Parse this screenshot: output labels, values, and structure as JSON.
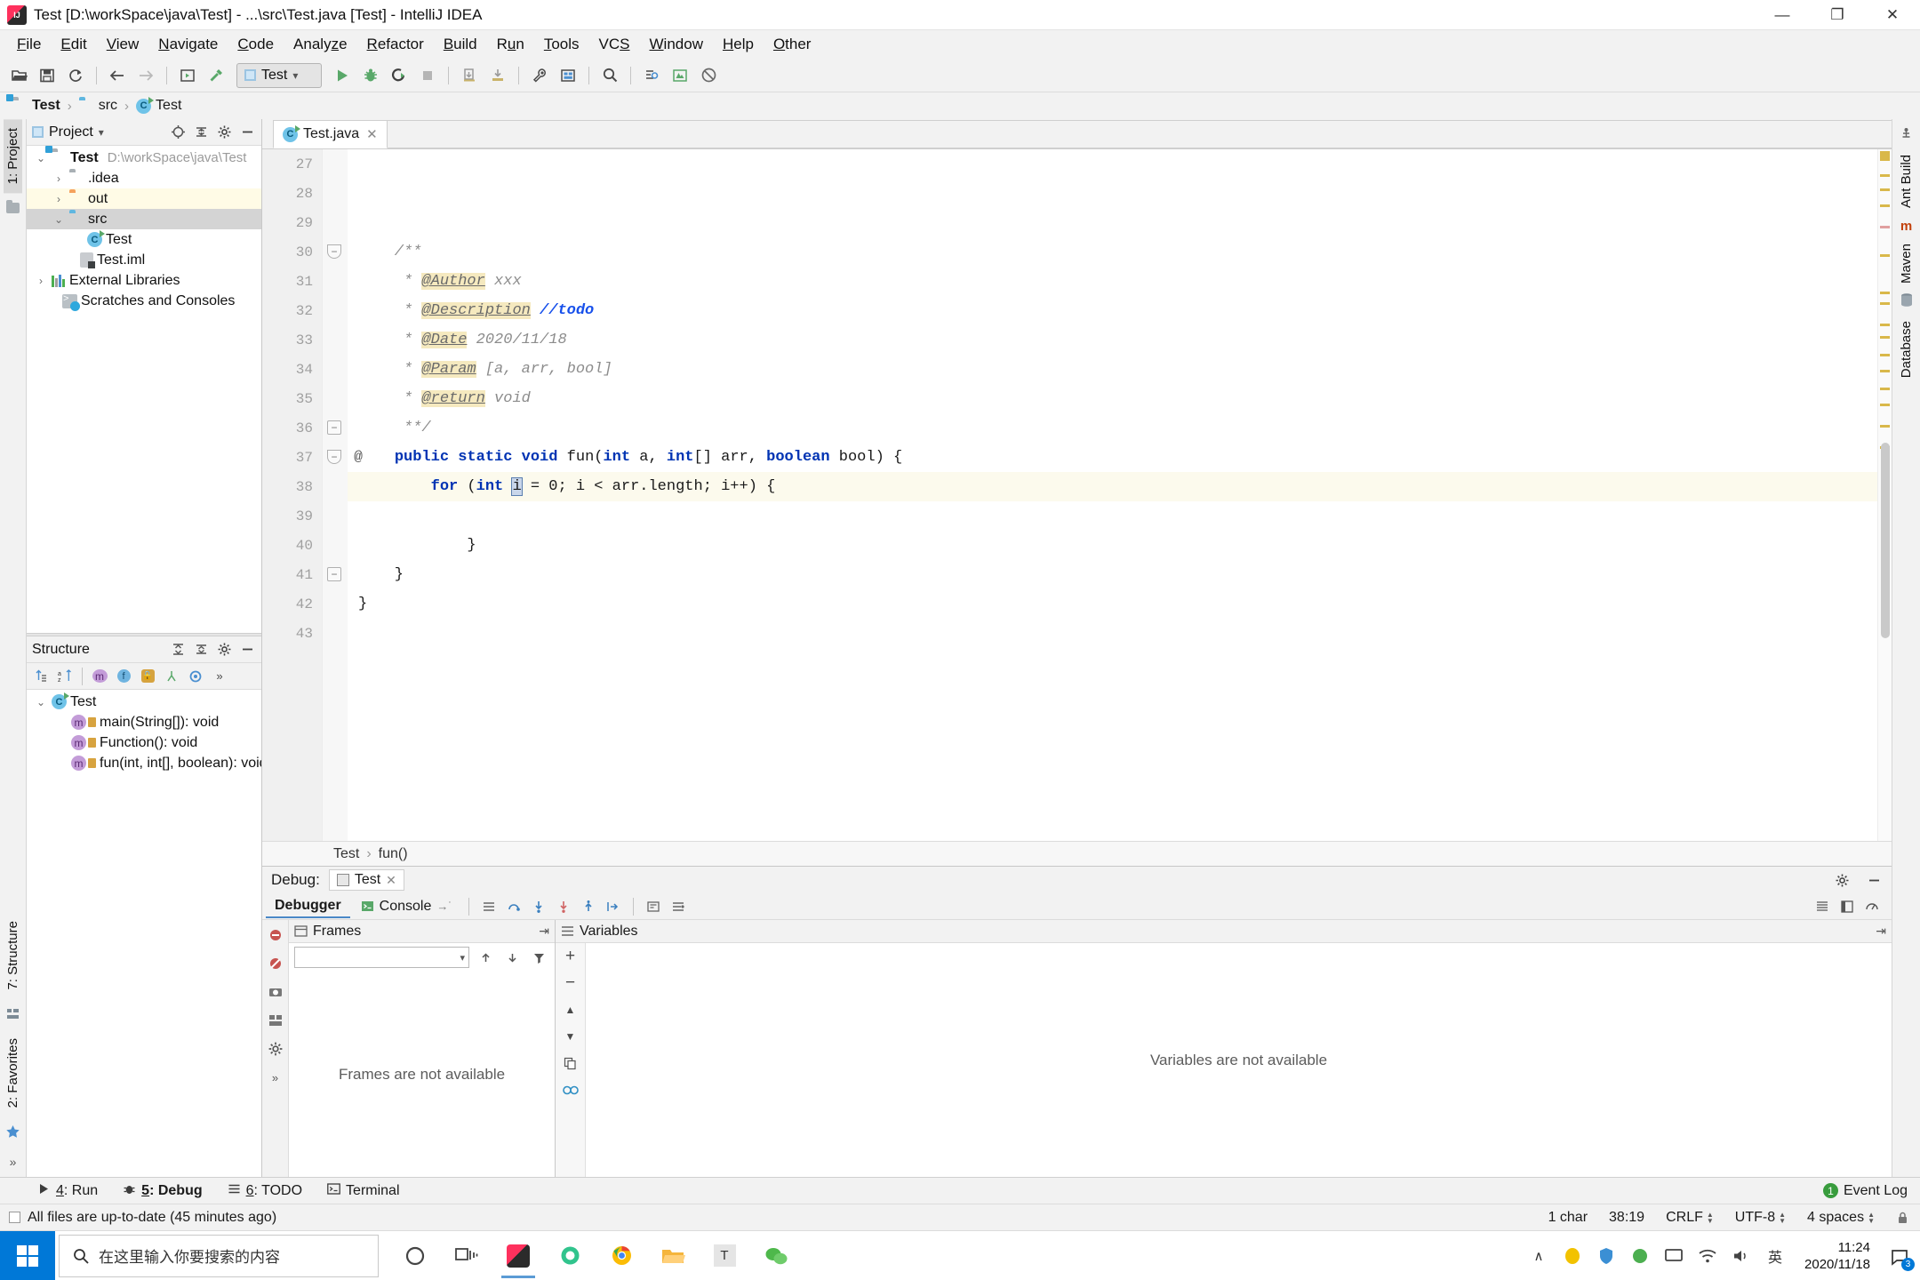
{
  "window": {
    "title": "Test [D:\\workSpace\\java\\Test] - ...\\src\\Test.java [Test] - IntelliJ IDEA",
    "app_icon": "intellij-idea-icon",
    "minimize": "—",
    "maximize": "❐",
    "close": "✕"
  },
  "menubar": {
    "items": [
      {
        "label": "File",
        "mnemonic": "F"
      },
      {
        "label": "Edit",
        "mnemonic": "E"
      },
      {
        "label": "View",
        "mnemonic": "V"
      },
      {
        "label": "Navigate",
        "mnemonic": "N"
      },
      {
        "label": "Code",
        "mnemonic": "C"
      },
      {
        "label": "Analyze",
        "mnemonic": "z"
      },
      {
        "label": "Refactor",
        "mnemonic": "R"
      },
      {
        "label": "Build",
        "mnemonic": "B"
      },
      {
        "label": "Run",
        "mnemonic": "u"
      },
      {
        "label": "Tools",
        "mnemonic": "T"
      },
      {
        "label": "VCS",
        "mnemonic": "S"
      },
      {
        "label": "Window",
        "mnemonic": "W"
      },
      {
        "label": "Help",
        "mnemonic": "H"
      },
      {
        "label": "Other",
        "mnemonic": "O"
      }
    ]
  },
  "toolbar": {
    "run_config": "Test",
    "icons": [
      "open-project-icon",
      "save-all-icon",
      "sync-icon",
      "back-icon",
      "forward-icon",
      "run-configurations-icon",
      "build-hammer-icon",
      "run-icon",
      "debug-icon",
      "run-with-coverage-icon",
      "stop-icon",
      "update-project-icon",
      "commit-icon",
      "settings-wrench-icon",
      "project-structure-icon",
      "search-everywhere-icon",
      "find-in-path-icon",
      "ant-build-icon",
      "no-access-icon"
    ]
  },
  "breadcrumb": {
    "items": [
      {
        "label": "Test",
        "icon": "module-folder-icon"
      },
      {
        "label": "src",
        "icon": "source-folder-icon"
      },
      {
        "label": "Test",
        "icon": "java-class-icon"
      }
    ],
    "separator": "›"
  },
  "left_strip": {
    "project_tab": "1: Project",
    "structure_tab": "7: Structure",
    "favorites_tab": "2: Favorites",
    "more": "»"
  },
  "right_strip": {
    "ant_build": "Ant Build",
    "maven": "Maven",
    "database": "Database"
  },
  "project_panel": {
    "title": "Project",
    "dropdown": "▾",
    "header_icons": [
      "locate-icon",
      "collapse-all-icon",
      "settings-gear-icon",
      "hide-icon"
    ],
    "tree": [
      {
        "label": "Test",
        "path": "D:\\workSpace\\java\\Test",
        "icon": "module-folder-icon",
        "arrow": "⌄",
        "indent": 0,
        "bold": true,
        "highlight": "none"
      },
      {
        "label": ".idea",
        "path": "",
        "icon": "gray-folder-icon",
        "arrow": "›",
        "indent": 1,
        "bold": false,
        "highlight": "none"
      },
      {
        "label": "out",
        "path": "",
        "icon": "orange-folder-icon",
        "arrow": "›",
        "indent": 1,
        "bold": false,
        "highlight": "yellow"
      },
      {
        "label": "src",
        "path": "",
        "icon": "blue-source-folder-icon",
        "arrow": "⌄",
        "indent": 1,
        "bold": false,
        "highlight": "gray"
      },
      {
        "label": "Test",
        "path": "",
        "icon": "java-class-icon",
        "arrow": "",
        "indent": 2,
        "bold": false,
        "highlight": "none"
      },
      {
        "label": "Test.iml",
        "path": "",
        "icon": "iml-module-file-icon",
        "arrow": "",
        "indent": 1.6,
        "bold": false,
        "highlight": "none"
      },
      {
        "label": "External Libraries",
        "path": "",
        "icon": "libraries-icon",
        "arrow": "›",
        "indent": 0,
        "bold": false,
        "highlight": "none"
      },
      {
        "label": "Scratches and Consoles",
        "path": "",
        "icon": "scratches-icon",
        "arrow": "",
        "indent": 0.6,
        "bold": false,
        "highlight": "none"
      }
    ]
  },
  "structure_panel": {
    "title": "Structure",
    "header_icons": [
      "expand-all-icon",
      "collapse-all-icon",
      "settings-gear-icon",
      "hide-icon"
    ],
    "toolbar_icons": [
      "sort-by-visibility-icon",
      "sort-alphabetically-icon",
      "show-fields-icon",
      "show-properties-icon",
      "show-non-public-icon",
      "show-inherited-icon",
      "show-anonymous-icon",
      "group-icon",
      "more-icon"
    ],
    "more": "»",
    "tree": [
      {
        "label": "Test",
        "icon": "java-class-icon",
        "arrow": "⌄",
        "indent": 0
      },
      {
        "label": "main(String[]): void",
        "icon": "method-icon",
        "indent": 1,
        "arrow": ""
      },
      {
        "label": "Function(): void",
        "icon": "method-icon",
        "indent": 1,
        "arrow": ""
      },
      {
        "label": "fun(int, int[], boolean): void",
        "icon": "method-icon",
        "indent": 1,
        "arrow": ""
      }
    ]
  },
  "editor": {
    "tab": {
      "label": "Test.java",
      "icon": "java-class-icon",
      "close": "✕"
    },
    "first_line": 27,
    "current_line": 38,
    "lines": [
      {
        "n": 27,
        "ann": "",
        "fold": "",
        "text": ""
      },
      {
        "n": 28,
        "ann": "",
        "fold": "",
        "text": ""
      },
      {
        "n": 29,
        "ann": "",
        "fold": "",
        "text": ""
      },
      {
        "n": 30,
        "ann": "",
        "fold": "tip",
        "text": "    /**"
      },
      {
        "n": 31,
        "ann": "",
        "fold": "",
        "text": "     * @Author xxx"
      },
      {
        "n": 32,
        "ann": "",
        "fold": "",
        "text": "     * @Description //todo"
      },
      {
        "n": 33,
        "ann": "",
        "fold": "",
        "text": "     * @Date 2020/11/18"
      },
      {
        "n": 34,
        "ann": "",
        "fold": "",
        "text": "     * @Param [a, arr, bool]"
      },
      {
        "n": 35,
        "ann": "",
        "fold": "",
        "text": "     * @return void"
      },
      {
        "n": 36,
        "ann": "",
        "fold": "top",
        "text": "     **/"
      },
      {
        "n": 37,
        "ann": "@",
        "fold": "tip",
        "text": "    public static void fun(int a, int[] arr, boolean bool) {"
      },
      {
        "n": 38,
        "ann": "",
        "fold": "",
        "text": "        for (int i = 0; i < arr.length; i++) {"
      },
      {
        "n": 39,
        "ann": "",
        "fold": "",
        "text": ""
      },
      {
        "n": 40,
        "ann": "",
        "fold": "",
        "text": "            }"
      },
      {
        "n": 41,
        "ann": "",
        "fold": "top",
        "text": "    }"
      },
      {
        "n": 42,
        "ann": "",
        "fold": "",
        "text": "}"
      },
      {
        "n": 43,
        "ann": "",
        "fold": "",
        "text": ""
      }
    ],
    "breadcrumb": {
      "items": [
        "Test",
        "fun()"
      ],
      "separator": "›"
    }
  },
  "debug": {
    "label": "Debug:",
    "session_tab": "Test",
    "session_close": "✕",
    "tabs": [
      {
        "label": "Debugger",
        "selected": true
      },
      {
        "label": "Console",
        "selected": false
      }
    ],
    "console_pin": "→˙",
    "toolbar_icons": [
      "show-execution-point-icon",
      "step-over-icon",
      "step-into-icon",
      "force-step-into-icon",
      "step-out-icon",
      "run-to-cursor-icon",
      "evaluate-expression-icon",
      "settings-icon"
    ],
    "right_icons": [
      "layout-settings-icon",
      "restore-layout-icon",
      "performance-icon"
    ],
    "left_icons": [
      "mute-breakpoints-icon",
      "view-breakpoints-icon",
      "restore-layout-icon",
      "camera-icon",
      "layout-icon",
      "settings-gear-icon"
    ],
    "frames": {
      "title": "Frames",
      "pin": "⇥",
      "thread_selector_value": "",
      "toolbar_icons": [
        "up-arrow-icon",
        "down-arrow-icon",
        "filter-icon"
      ],
      "empty_text": "Frames are not available"
    },
    "variables": {
      "title": "Variables",
      "pin": "⇥",
      "empty_text": "Variables are not available",
      "tool_icons": [
        "add-watch-icon",
        "remove-watch-icon",
        "move-up-icon",
        "move-down-icon",
        "copy-icon",
        "inspect-icon"
      ]
    },
    "panel_header_icons": [
      "settings-gear-icon",
      "hide-icon"
    ]
  },
  "bottom_tabs": {
    "items": [
      {
        "label": "4: Run",
        "mnemonic": "4",
        "icon": "run-icon",
        "selected": false
      },
      {
        "label": "5: Debug",
        "mnemonic": "5",
        "icon": "debug-icon",
        "selected": true
      },
      {
        "label": "6: TODO",
        "mnemonic": "6",
        "icon": "todo-icon",
        "selected": false
      },
      {
        "label": "Terminal",
        "mnemonic": "",
        "icon": "terminal-icon",
        "selected": false
      }
    ],
    "event_log": {
      "label": "Event Log",
      "count": "1"
    }
  },
  "statusbar": {
    "message": "All files are up-to-date (45 minutes ago)",
    "chars": "1 char",
    "caret": "38:19",
    "line_separator": "CRLF",
    "encoding": "UTF-8",
    "indent": "4 spaces",
    "lock_icon": "lock-icon"
  },
  "taskbar": {
    "search_placeholder": "在这里输入你要搜索的内容",
    "start_icon": "windows-start-icon",
    "apps": [
      {
        "name": "cortana-icon"
      },
      {
        "name": "task-view-icon"
      },
      {
        "name": "intellij-idea-icon"
      },
      {
        "name": "browser-360-icon"
      },
      {
        "name": "chrome-icon"
      },
      {
        "name": "file-explorer-icon"
      },
      {
        "name": "typora-icon"
      },
      {
        "name": "wechat-icon"
      }
    ],
    "tray": {
      "chevron": "∧",
      "icons": [
        "qq-icon",
        "shield-icon",
        "green-icon",
        "monitor-icon",
        "network-icon",
        "volume-icon"
      ],
      "ime": "英",
      "time": "11:24",
      "date": "2020/11/18",
      "notification_count": "3"
    }
  },
  "colors": {
    "accent_blue": "#0078d7",
    "ide_bg": "#f2f2f2",
    "editor_bg": "#ffffff",
    "keyword": "#0033b3",
    "comment": "#8c8c8c",
    "todo": "#1750eb",
    "number": "#1750eb",
    "javadoc_highlight": "#f5e9bf",
    "current_line": "#fcfaed",
    "selected_row": "#d4d4d4",
    "yellow_row": "#fffbe6"
  }
}
